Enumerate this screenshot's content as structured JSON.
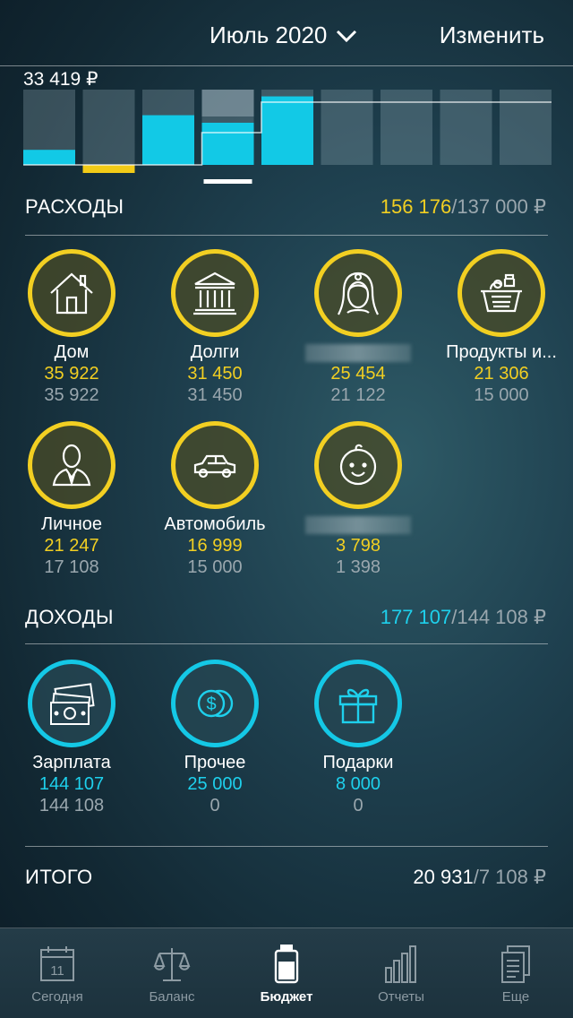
{
  "header": {
    "month": "Июль 2020",
    "edit_label": "Изменить"
  },
  "balance": {
    "label": "33 419 ₽"
  },
  "chart_data": {
    "type": "bar",
    "label": "33 419 ₽",
    "selected_index": 3,
    "bars": [
      {
        "fill": 0.2,
        "color": "#12c9e6",
        "underline": false
      },
      {
        "fill": 0.09,
        "color": "#f2cb17",
        "underline": true
      },
      {
        "fill": 0.66,
        "color": "#12c9e6",
        "underline": false
      },
      {
        "fill": 0.56,
        "color": "#12c9e6",
        "underline": false
      },
      {
        "fill": 0.91,
        "color": "#12c9e6",
        "underline": false
      },
      {
        "fill": 0,
        "color": "#12c9e6",
        "underline": false
      },
      {
        "fill": 0,
        "color": "#12c9e6",
        "underline": false
      },
      {
        "fill": 0,
        "color": "#12c9e6",
        "underline": false
      },
      {
        "fill": 0,
        "color": "#12c9e6",
        "underline": false
      }
    ]
  },
  "expenses": {
    "title": "РАСХОДЫ",
    "actual": "156 176",
    "planned": "/137 000 ₽",
    "categories": [
      {
        "name": "Дом",
        "actual": "35 922",
        "planned": "35 922",
        "icon": "house-icon"
      },
      {
        "name": "Долги",
        "actual": "31 450",
        "planned": "31 450",
        "icon": "bank-icon"
      },
      {
        "name": "",
        "actual": "25 454",
        "planned": "21 122",
        "icon": "bride-icon"
      },
      {
        "name": "Продукты и...",
        "actual": "21 306",
        "planned": "15 000",
        "icon": "grocery-basket-icon"
      },
      {
        "name": "Личное",
        "actual": "21 247",
        "planned": "17 108",
        "icon": "person-icon"
      },
      {
        "name": "Автомобиль",
        "actual": "16 999",
        "planned": "15 000",
        "icon": "car-icon"
      },
      {
        "name": "",
        "actual": "3 798",
        "planned": "1 398",
        "icon": "baby-icon"
      }
    ]
  },
  "income": {
    "title": "ДОХОДЫ",
    "actual": "177 107",
    "planned": "/144 108 ₽",
    "categories": [
      {
        "name": "Зарплата",
        "actual": "144 107",
        "planned": "144 108",
        "icon": "money-icon"
      },
      {
        "name": "Прочее",
        "actual": "25 000",
        "planned": "0",
        "icon": "coins-icon"
      },
      {
        "name": "Подарки",
        "actual": "8 000",
        "planned": "0",
        "icon": "gift-icon"
      }
    ]
  },
  "total": {
    "title": "ИТОГО",
    "actual": "20 931",
    "planned": "/7 108 ₽"
  },
  "tabbar": {
    "today": {
      "label": "Сегодня",
      "day": "11"
    },
    "balance": {
      "label": "Баланс"
    },
    "budget": {
      "label": "Бюджет"
    },
    "reports": {
      "label": "Отчеты"
    },
    "more": {
      "label": "Еще"
    }
  }
}
